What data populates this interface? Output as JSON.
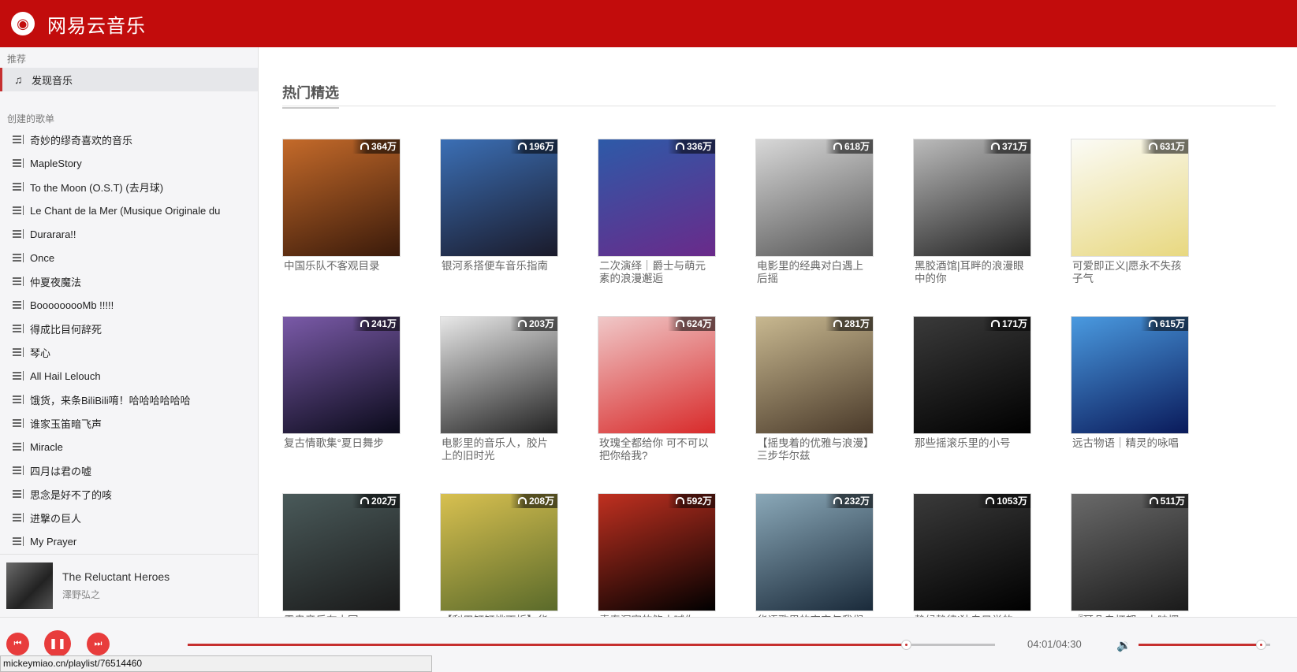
{
  "app": {
    "title": "网易云音乐",
    "brand_color": "#c20c0c",
    "accent_color": "#c62f2f",
    "logo_icon": "netease-logo-icon"
  },
  "sidebar": {
    "recommend_label": "推荐",
    "discover_label": "发现音乐",
    "created_label": "创建的歌单",
    "playlists": [
      "奇妙的缪奇喜欢的音乐",
      "MapleStory",
      "To the Moon (O.S.T) (去月球)",
      "Le Chant de la Mer (Musique Originale du",
      "Durarara!!",
      "Once",
      "仲夏夜魔法",
      "BooooooooMb !!!!!",
      "得成比目何辞死",
      "琴心",
      "All Hail Lelouch",
      "饿货，来条BiliBili唷！哈哈哈哈哈哈",
      "谁家玉笛暗飞声",
      "Miracle",
      "四月は君の嘘",
      "思念是好不了的咳",
      "进撃の巨人",
      "My Prayer"
    ]
  },
  "now_playing": {
    "title": "The Reluctant Heroes",
    "artist": "澤野弘之"
  },
  "main": {
    "section_title": "热门精选",
    "cards": [
      {
        "title": "中国乐队不客观目录",
        "count": "364万",
        "colors": [
          "#c46a2a",
          "#3a1a0a"
        ]
      },
      {
        "title": "银河系搭便车音乐指南",
        "count": "196万",
        "colors": [
          "#3b6fb5",
          "#1a1a2a"
        ]
      },
      {
        "title": "二次演绎｜爵士与萌元素的浪漫邂逅",
        "count": "336万",
        "colors": [
          "#2d5aa8",
          "#6a2a8a"
        ]
      },
      {
        "title": "电影里的经典对白遇上后摇",
        "count": "618万",
        "colors": [
          "#d8d8d8",
          "#555555"
        ]
      },
      {
        "title": "黑胶酒馆|耳畔的浪漫眼中的你",
        "count": "371万",
        "colors": [
          "#bbbbbb",
          "#222222"
        ]
      },
      {
        "title": "可爱即正义|愿永不失孩子气",
        "count": "631万",
        "colors": [
          "#fbfbf6",
          "#e8d880"
        ]
      },
      {
        "title": "复古情歌集°夏日舞步",
        "count": "241万",
        "colors": [
          "#7a5aa8",
          "#0a0a1a"
        ]
      },
      {
        "title": "电影里的音乐人，胶片上的旧时光",
        "count": "203万",
        "colors": [
          "#e8e8e8",
          "#222222"
        ]
      },
      {
        "title": "玫瑰全都给你 可不可以把你给我?",
        "count": "624万",
        "colors": [
          "#f0c8c8",
          "#d82a2a"
        ]
      },
      {
        "title": "【摇曳着的优雅与浪漫】三步华尔兹",
        "count": "281万",
        "colors": [
          "#c8b890",
          "#4a3a2a"
        ]
      },
      {
        "title": "那些摇滚乐里的小号",
        "count": "171万",
        "colors": [
          "#3a3a3a",
          "#000000"
        ]
      },
      {
        "title": "远古物语｜精灵的咏唱",
        "count": "615万",
        "colors": [
          "#4a9ae0",
          "#0a1a5a"
        ]
      },
      {
        "title": "雷鬼音乐在中国",
        "count": "202万",
        "colors": [
          "#4a5a5a",
          "#1a1a1a"
        ]
      },
      {
        "title": "【利用钉钉挑丁折】华",
        "count": "208万",
        "colors": [
          "#d8c050",
          "#5a6a2a"
        ]
      },
      {
        "title": "青春洞穿的鲍小喊你",
        "count": "592万",
        "colors": [
          "#c03020",
          "#000000"
        ]
      },
      {
        "title": "华语歌里的宇宙与我们",
        "count": "232万",
        "colors": [
          "#8aa8b8",
          "#1a2a3a"
        ]
      },
      {
        "title": "静候静律|独自只觉的",
        "count": "1053万",
        "colors": [
          "#3a3a3a",
          "#000000"
        ]
      },
      {
        "title": "『耳朵自杯都』上映摆",
        "count": "511万",
        "colors": [
          "#6a6a6a",
          "#1a1a1a"
        ]
      }
    ]
  },
  "player": {
    "current_time": "04:01",
    "total_time": "04:30",
    "time_display": "04:01/04:30",
    "progress_percent": 89,
    "volume_percent": 93
  },
  "status_bar": {
    "url": "mickeymiao.cn/playlist/76514460"
  }
}
